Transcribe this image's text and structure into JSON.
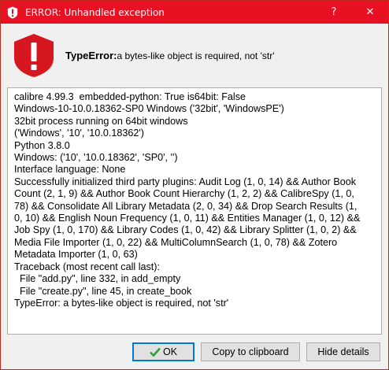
{
  "window": {
    "title": "ERROR: Unhandled exception",
    "help_glyph": "?",
    "close_glyph": "✕"
  },
  "colors": {
    "titlebar": "#e81123",
    "error_icon": "#d7171f"
  },
  "header": {
    "error_type": "TypeError:",
    "error_message": "a bytes-like object is required, not 'str'"
  },
  "details": {
    "lines": [
      "calibre 4.99.3  embedded-python: True is64bit: False",
      "Windows-10-10.0.18362-SP0 Windows ('32bit', 'WindowsPE')",
      "32bit process running on 64bit windows",
      "('Windows', '10', '10.0.18362')",
      "Python 3.8.0",
      "Windows: ('10', '10.0.18362', 'SP0', '')",
      "Interface language: None",
      "Successfully initialized third party plugins: Audit Log (1, 0, 14) && Author Book",
      "Count (2, 1, 9) && Author Book Count Hierarchy (1, 2, 2) && CalibreSpy (1, 0,",
      "78) && Consolidate All Library Metadata (2, 0, 34) && Drop Search Results (1,",
      "0, 10) && English Noun Frequency (1, 0, 11) && Entities Manager (1, 0, 12) &&",
      "Job Spy (1, 0, 170) && Library Codes (1, 0, 42) && Library Splitter (1, 0, 2) &&",
      "Media File Importer (1, 0, 22) && MultiColumnSearch (1, 0, 78) && Zotero",
      "Metadata Importer (1, 0, 63)",
      "Traceback (most recent call last):",
      "  File \"add.py\", line 332, in add_empty",
      "  File \"create.py\", line 45, in create_book",
      "TypeError: a bytes-like object is required, not 'str'"
    ]
  },
  "buttons": {
    "ok_label": "OK",
    "copy_label": "Copy to clipboard",
    "hide_label": "Hide details"
  }
}
